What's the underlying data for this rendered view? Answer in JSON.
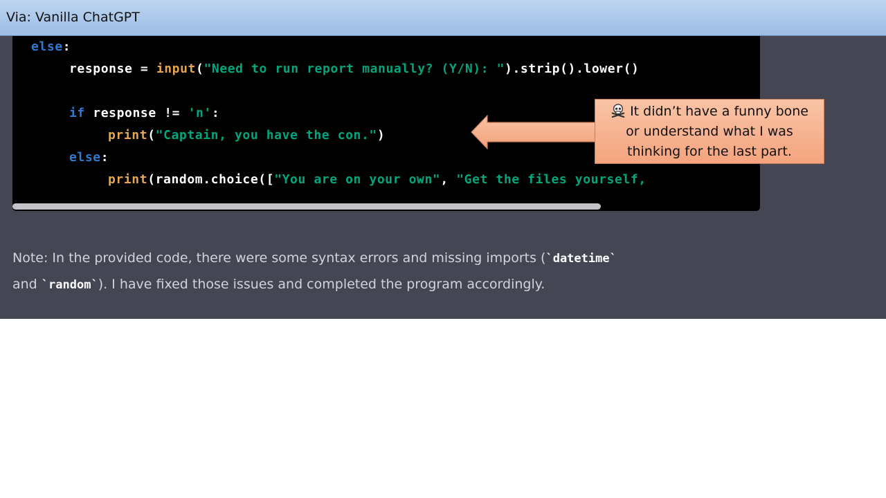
{
  "banner": {
    "title": "Via: Vanilla ChatGPT"
  },
  "code": {
    "l1_kw": "else",
    "l1_punct": ":",
    "l2_indent": "    ",
    "l2_var": "response = ",
    "l2_fn": "input",
    "l2_open": "(",
    "l2_str": "\"Need to run report manually? (Y/N): \"",
    "l2_rest": ").strip().lower()",
    "l3_kw": "if",
    "l3_rest": " response != ",
    "l3_str": "'n'",
    "l3_colon": ":",
    "l4_fn": "print",
    "l4_open": "(",
    "l4_str": "\"Captain, you have the con.\"",
    "l4_close": ")",
    "l5_kw": "else",
    "l5_colon": ":",
    "l6_fn": "print",
    "l6_mid": "(random.choice([",
    "l6_str1": "\"You are on your own\"",
    "l6_comma": ", ",
    "l6_str2": "\"Get the files yourself,"
  },
  "note": {
    "text1": "Note: In the provided code, there were some syntax errors and missing imports (",
    "code1": "`datetime`",
    "text2": "and ",
    "code2": "`random`",
    "text3": "). I have fixed those issues and completed the program accordingly."
  },
  "callout": {
    "icon": "skull-crossbones-icon",
    "line1": "It didn’t have a funny bone",
    "line2": "or understand what I was",
    "line3": "thinking for the last part."
  },
  "colors": {
    "panel": "#444654",
    "code_bg": "#000000",
    "keyword": "#2f7bd2",
    "function": "#e9a54a",
    "string": "#00a67d",
    "callout_fill": "#f4a47e",
    "banner_fill": "#9dbde6"
  }
}
